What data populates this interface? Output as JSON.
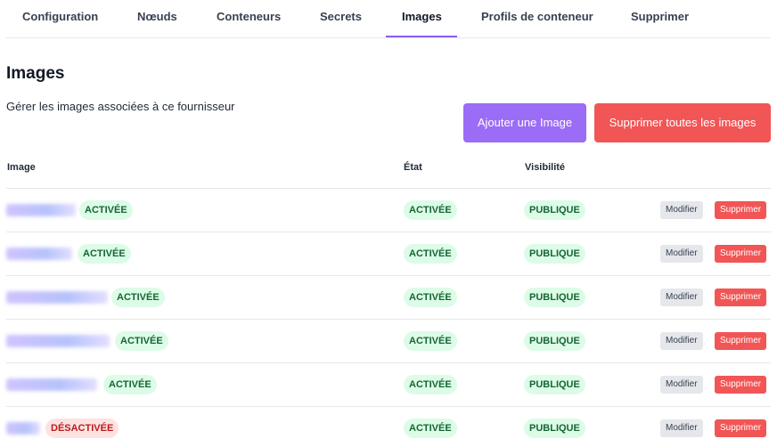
{
  "tabs": [
    {
      "label": "Configuration"
    },
    {
      "label": "Nœuds"
    },
    {
      "label": "Conteneurs"
    },
    {
      "label": "Secrets"
    },
    {
      "label": "Images",
      "active": true
    },
    {
      "label": "Profils de conteneur"
    },
    {
      "label": "Supprimer"
    }
  ],
  "page": {
    "title": "Images",
    "subtitle": "Gérer les images associées à ce fournisseur",
    "add_button": "Ajouter une Image",
    "delete_all_button": "Supprimer toutes les images"
  },
  "table": {
    "headers": {
      "image": "Image",
      "state": "État",
      "visibility": "Visibilité"
    },
    "rows": [
      {
        "name_status": "ACTIVÉE",
        "state": "ACTIVÉE",
        "visibility": "PUBLIQUE",
        "edit": "Modifier",
        "delete": "Supprimer"
      },
      {
        "name_status": "ACTIVÉE",
        "state": "ACTIVÉE",
        "visibility": "PUBLIQUE",
        "edit": "Modifier",
        "delete": "Supprimer"
      },
      {
        "name_status": "ACTIVÉE",
        "state": "ACTIVÉE",
        "visibility": "PUBLIQUE",
        "edit": "Modifier",
        "delete": "Supprimer"
      },
      {
        "name_status": "ACTIVÉE",
        "state": "ACTIVÉE",
        "visibility": "PUBLIQUE",
        "edit": "Modifier",
        "delete": "Supprimer"
      },
      {
        "name_status": "ACTIVÉE",
        "state": "ACTIVÉE",
        "visibility": "PUBLIQUE",
        "edit": "Modifier",
        "delete": "Supprimer"
      },
      {
        "name_status": "DÉSACTIVÉE",
        "state": "ACTIVÉE",
        "visibility": "PUBLIQUE",
        "edit": "Modifier",
        "delete": "Supprimer"
      }
    ]
  },
  "colors": {
    "accent": "#9b6cf5",
    "danger": "#f25555",
    "success_bg": "#dcfce7",
    "success_text": "#166534",
    "danger_bg": "#fee2e2",
    "danger_text": "#b91c1c"
  }
}
